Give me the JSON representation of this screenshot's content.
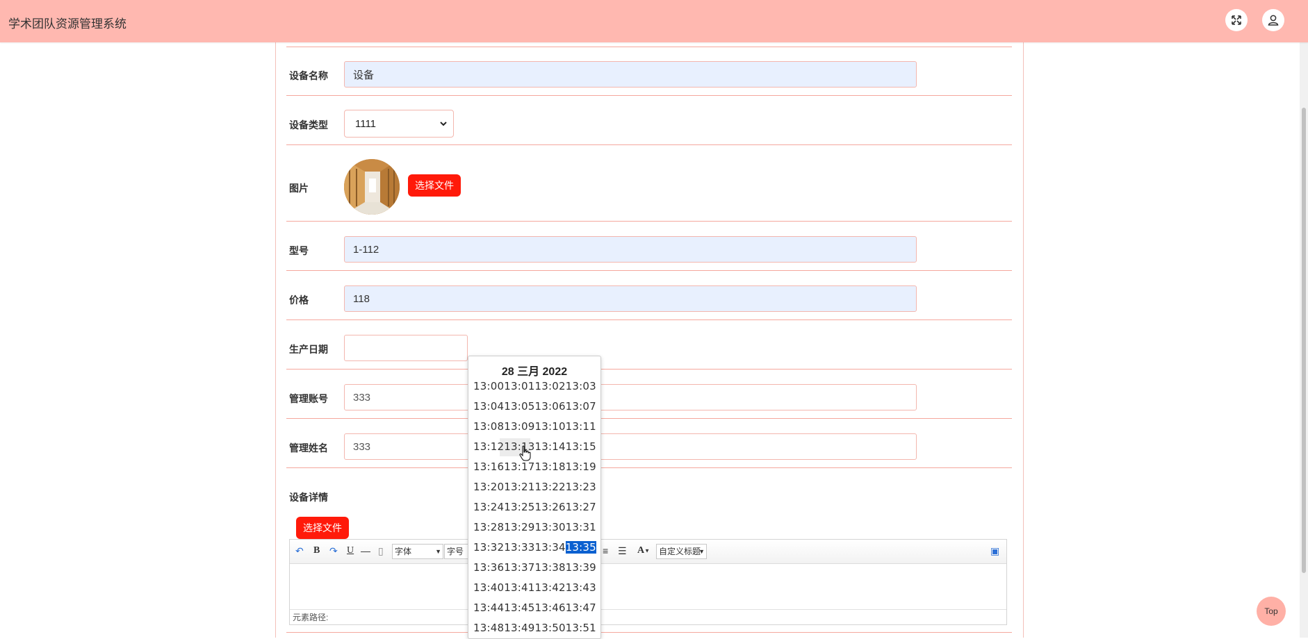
{
  "app": {
    "title": "学术团队资源管理系统"
  },
  "header": {
    "icons": [
      "fullscreen-icon",
      "user-icon"
    ]
  },
  "form": {
    "device_name": {
      "label": "设备名称",
      "value": "设备"
    },
    "device_type": {
      "label": "设备类型",
      "selected": "1111"
    },
    "image": {
      "label": "图片",
      "button": "选择文件"
    },
    "model": {
      "label": "型号",
      "value": "1-112"
    },
    "price": {
      "label": "价格",
      "value": "118"
    },
    "production_date": {
      "label": "生产日期",
      "value": ""
    },
    "admin_account": {
      "label": "管理账号",
      "value": "333"
    },
    "admin_name": {
      "label": "管理姓名",
      "value": "333"
    },
    "details": {
      "label": "设备详情",
      "button": "选择文件",
      "toolbar": {
        "font": "字体",
        "size": "字号",
        "custom_title": "自定义标题"
      },
      "path_label": "元素路径:"
    }
  },
  "datepicker": {
    "title": "28 三月 2022",
    "rows": [
      "13:0013:0113:0213:03",
      "13:0413:0513:0613:07",
      "13:0813:0913:1013:11",
      "13:1213:1313:1413:15",
      "13:1613:1713:1813:19",
      "13:2013:2113:2213:23",
      "13:2413:2513:2613:27",
      "13:2813:2913:3013:31",
      "13:3213:3313:34",
      "13:3613:3713:3813:39",
      "13:4013:4113:4213:43",
      "13:4413:4513:4613:47",
      "13:4813:4913:5013:51"
    ],
    "selected": "13:35"
  },
  "back_to_top": "Top",
  "colors": {
    "header_bg": "#ffb8b0",
    "accent_red": "#ff1a0a",
    "row_border": "#f5a79d",
    "selected_blue": "#0a60d0"
  }
}
